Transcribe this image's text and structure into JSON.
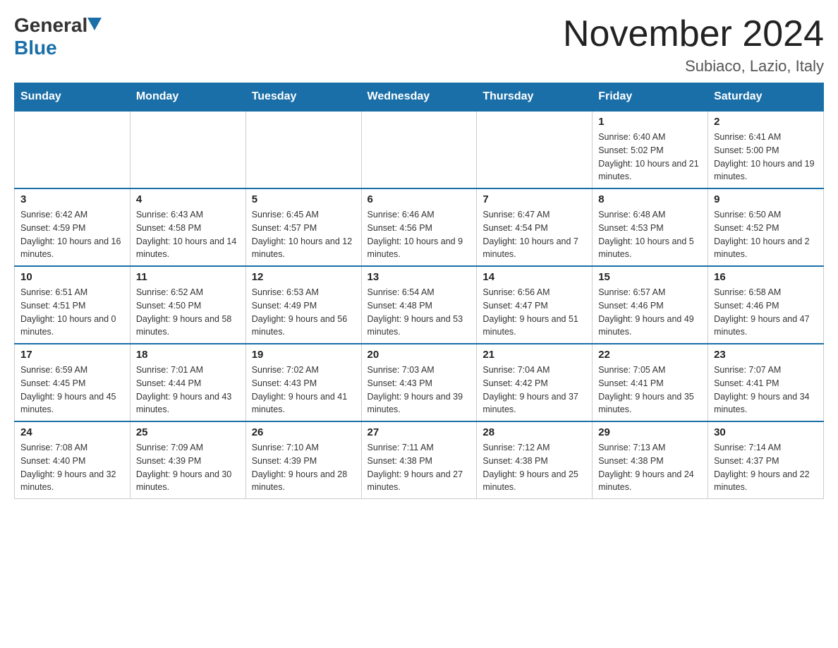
{
  "header": {
    "logo_general": "General",
    "logo_blue": "Blue",
    "title": "November 2024",
    "subtitle": "Subiaco, Lazio, Italy"
  },
  "days_of_week": [
    "Sunday",
    "Monday",
    "Tuesday",
    "Wednesday",
    "Thursday",
    "Friday",
    "Saturday"
  ],
  "weeks": [
    [
      {
        "day": "",
        "info": ""
      },
      {
        "day": "",
        "info": ""
      },
      {
        "day": "",
        "info": ""
      },
      {
        "day": "",
        "info": ""
      },
      {
        "day": "",
        "info": ""
      },
      {
        "day": "1",
        "info": "Sunrise: 6:40 AM\nSunset: 5:02 PM\nDaylight: 10 hours and 21 minutes."
      },
      {
        "day": "2",
        "info": "Sunrise: 6:41 AM\nSunset: 5:00 PM\nDaylight: 10 hours and 19 minutes."
      }
    ],
    [
      {
        "day": "3",
        "info": "Sunrise: 6:42 AM\nSunset: 4:59 PM\nDaylight: 10 hours and 16 minutes."
      },
      {
        "day": "4",
        "info": "Sunrise: 6:43 AM\nSunset: 4:58 PM\nDaylight: 10 hours and 14 minutes."
      },
      {
        "day": "5",
        "info": "Sunrise: 6:45 AM\nSunset: 4:57 PM\nDaylight: 10 hours and 12 minutes."
      },
      {
        "day": "6",
        "info": "Sunrise: 6:46 AM\nSunset: 4:56 PM\nDaylight: 10 hours and 9 minutes."
      },
      {
        "day": "7",
        "info": "Sunrise: 6:47 AM\nSunset: 4:54 PM\nDaylight: 10 hours and 7 minutes."
      },
      {
        "day": "8",
        "info": "Sunrise: 6:48 AM\nSunset: 4:53 PM\nDaylight: 10 hours and 5 minutes."
      },
      {
        "day": "9",
        "info": "Sunrise: 6:50 AM\nSunset: 4:52 PM\nDaylight: 10 hours and 2 minutes."
      }
    ],
    [
      {
        "day": "10",
        "info": "Sunrise: 6:51 AM\nSunset: 4:51 PM\nDaylight: 10 hours and 0 minutes."
      },
      {
        "day": "11",
        "info": "Sunrise: 6:52 AM\nSunset: 4:50 PM\nDaylight: 9 hours and 58 minutes."
      },
      {
        "day": "12",
        "info": "Sunrise: 6:53 AM\nSunset: 4:49 PM\nDaylight: 9 hours and 56 minutes."
      },
      {
        "day": "13",
        "info": "Sunrise: 6:54 AM\nSunset: 4:48 PM\nDaylight: 9 hours and 53 minutes."
      },
      {
        "day": "14",
        "info": "Sunrise: 6:56 AM\nSunset: 4:47 PM\nDaylight: 9 hours and 51 minutes."
      },
      {
        "day": "15",
        "info": "Sunrise: 6:57 AM\nSunset: 4:46 PM\nDaylight: 9 hours and 49 minutes."
      },
      {
        "day": "16",
        "info": "Sunrise: 6:58 AM\nSunset: 4:46 PM\nDaylight: 9 hours and 47 minutes."
      }
    ],
    [
      {
        "day": "17",
        "info": "Sunrise: 6:59 AM\nSunset: 4:45 PM\nDaylight: 9 hours and 45 minutes."
      },
      {
        "day": "18",
        "info": "Sunrise: 7:01 AM\nSunset: 4:44 PM\nDaylight: 9 hours and 43 minutes."
      },
      {
        "day": "19",
        "info": "Sunrise: 7:02 AM\nSunset: 4:43 PM\nDaylight: 9 hours and 41 minutes."
      },
      {
        "day": "20",
        "info": "Sunrise: 7:03 AM\nSunset: 4:43 PM\nDaylight: 9 hours and 39 minutes."
      },
      {
        "day": "21",
        "info": "Sunrise: 7:04 AM\nSunset: 4:42 PM\nDaylight: 9 hours and 37 minutes."
      },
      {
        "day": "22",
        "info": "Sunrise: 7:05 AM\nSunset: 4:41 PM\nDaylight: 9 hours and 35 minutes."
      },
      {
        "day": "23",
        "info": "Sunrise: 7:07 AM\nSunset: 4:41 PM\nDaylight: 9 hours and 34 minutes."
      }
    ],
    [
      {
        "day": "24",
        "info": "Sunrise: 7:08 AM\nSunset: 4:40 PM\nDaylight: 9 hours and 32 minutes."
      },
      {
        "day": "25",
        "info": "Sunrise: 7:09 AM\nSunset: 4:39 PM\nDaylight: 9 hours and 30 minutes."
      },
      {
        "day": "26",
        "info": "Sunrise: 7:10 AM\nSunset: 4:39 PM\nDaylight: 9 hours and 28 minutes."
      },
      {
        "day": "27",
        "info": "Sunrise: 7:11 AM\nSunset: 4:38 PM\nDaylight: 9 hours and 27 minutes."
      },
      {
        "day": "28",
        "info": "Sunrise: 7:12 AM\nSunset: 4:38 PM\nDaylight: 9 hours and 25 minutes."
      },
      {
        "day": "29",
        "info": "Sunrise: 7:13 AM\nSunset: 4:38 PM\nDaylight: 9 hours and 24 minutes."
      },
      {
        "day": "30",
        "info": "Sunrise: 7:14 AM\nSunset: 4:37 PM\nDaylight: 9 hours and 22 minutes."
      }
    ]
  ]
}
